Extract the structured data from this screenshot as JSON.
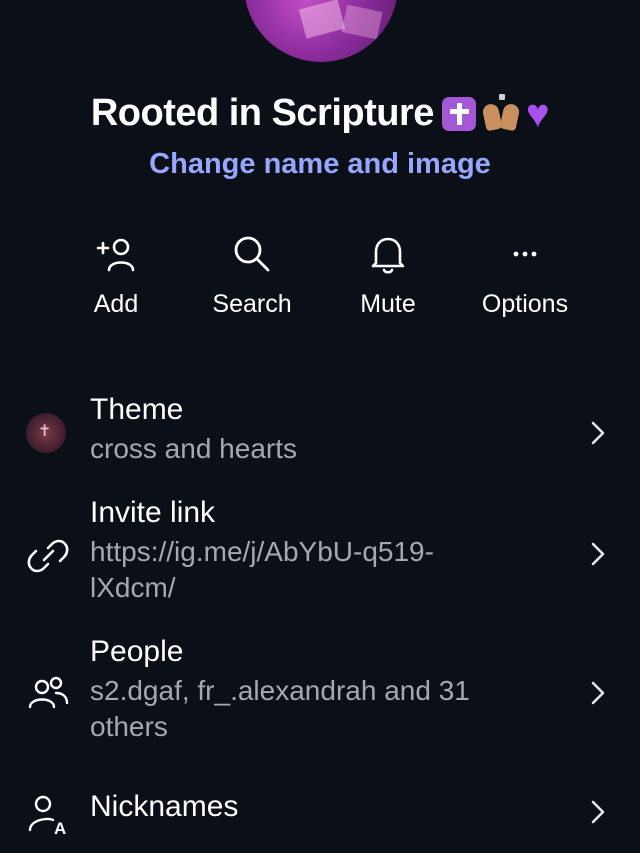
{
  "header": {
    "group_name": "Rooted in Scripture",
    "change_link": "Change name and image"
  },
  "actions": [
    {
      "label": "Add",
      "icon": "add-person-icon"
    },
    {
      "label": "Search",
      "icon": "search-icon"
    },
    {
      "label": "Mute",
      "icon": "bell-icon"
    },
    {
      "label": "Options",
      "icon": "more-icon"
    }
  ],
  "settings": {
    "theme": {
      "title": "Theme",
      "subtitle": "cross and hearts"
    },
    "invite": {
      "title": "Invite link",
      "line1": "https://ig.me/j/AbYbU-q519-",
      "line2": "lXdcm/"
    },
    "people": {
      "title": "People",
      "line1": "s2.dgaf, fr_.alexandrah and 31",
      "line2": "others"
    },
    "nicknames": {
      "title": "Nicknames"
    }
  },
  "colors": {
    "background": "#0b0f18",
    "link": "#97a7ff",
    "subtext": "#a4a8b0"
  }
}
